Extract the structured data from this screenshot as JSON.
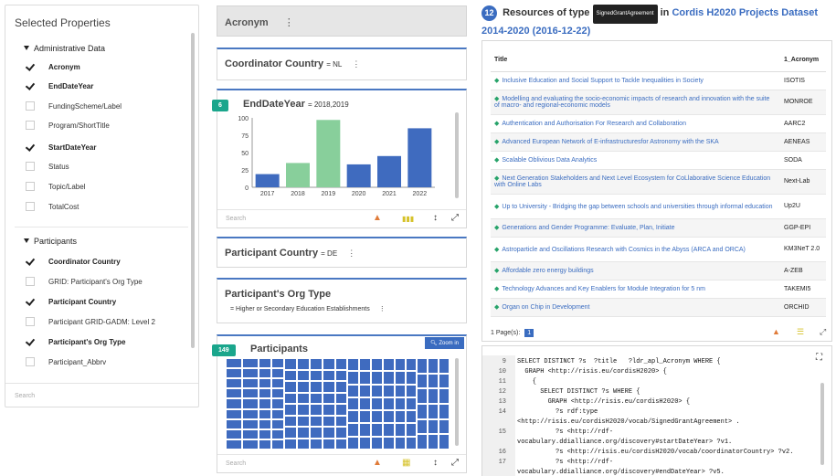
{
  "left_panel": {
    "title": "Selected Properties",
    "sections": [
      {
        "label": "Administrative Data",
        "items": [
          {
            "label": "Acronym",
            "checked": true
          },
          {
            "label": "EndDateYear",
            "checked": true
          },
          {
            "label": "FundingScheme/Label",
            "checked": false
          },
          {
            "label": "Program/ShortTitle",
            "checked": false
          },
          {
            "label": "StartDateYear",
            "checked": true
          },
          {
            "label": "Status",
            "checked": false
          },
          {
            "label": "Topic/Label",
            "checked": false
          },
          {
            "label": "TotalCost",
            "checked": false
          }
        ]
      },
      {
        "label": "Participants",
        "items": [
          {
            "label": "Coordinator Country",
            "checked": true
          },
          {
            "label": "GRID: Participant's Org Type",
            "checked": false
          },
          {
            "label": "Participant Country",
            "checked": true
          },
          {
            "label": "Participant GRID-GADM: Level 2",
            "checked": false
          },
          {
            "label": "Participant's Org Type",
            "checked": true
          },
          {
            "label": "Participant_Abbrv",
            "checked": false
          }
        ]
      }
    ],
    "search_placeholder": "Search"
  },
  "cards": {
    "acronym": {
      "title": "Acronym",
      "menu": "⋮"
    },
    "coordinator": {
      "title": "Coordinator Country",
      "filter": "= NL",
      "menu": "⋮"
    },
    "enddate": {
      "badge": "6",
      "title": "EndDateYear",
      "filter": "= 2018,2019",
      "search": "Search"
    },
    "participant_country": {
      "title": "Participant Country",
      "filter": "= DE",
      "menu": "⋮"
    },
    "org_type": {
      "title": "Participant's Org Type",
      "filter": "= Higher or Secondary Education Establishments",
      "menu": "⋮"
    },
    "participants": {
      "badge": "149",
      "title": "Participants",
      "zoom": "Zoom in",
      "search": "Search"
    }
  },
  "chart_data": {
    "type": "bar",
    "categories": [
      "2017",
      "2018",
      "2019",
      "2020",
      "2021",
      "2022"
    ],
    "values": [
      19,
      35,
      97,
      33,
      45,
      85
    ],
    "highlighted": [
      "2018",
      "2019"
    ],
    "ylim": [
      0,
      100
    ],
    "yticks": [
      "0",
      "25",
      "50",
      "75",
      "100"
    ],
    "colors": {
      "default": "#3f6bbf",
      "selected": "#88cf9b"
    }
  },
  "results": {
    "count": "12",
    "prefix": "Resources of type",
    "type_tag": "SignedGrantAgreement",
    "in_word": "in",
    "dataset": "Cordis H2020 Projects Dataset 2014-2020 (2016-12-22)",
    "columns": [
      "Title",
      "1_Acronym"
    ],
    "rows": [
      {
        "title": "Inclusive Education and Social Support to Tackle Inequalities in Society",
        "acronym": "ISOTIS"
      },
      {
        "title": "Modelling and evaluating the socio-economic impacts of research and innovation with the suite of macro- and regional-economic models",
        "acronym": "MONROE"
      },
      {
        "title": "Authentication and Authorisation For Research and Collaboration",
        "acronym": "AARC2"
      },
      {
        "title": "Advanced European Network of E-infrastructuresfor Astronomy with the SKA",
        "acronym": "AENEAS"
      },
      {
        "title": "Scalable Oblivious Data Analytics",
        "acronym": "SODA"
      },
      {
        "title": "Next Generation Stakeholders and Next Level Ecosystem for CoLlaborative Science Education with Online Labs",
        "acronym": "Next-Lab"
      },
      {
        "title": "Up to University - Bridging the gap between schools and universities through informal education",
        "acronym": "Up2U"
      },
      {
        "title": "Generations and Gender Programme: Evaluate, Plan, Initiate",
        "acronym": "GGP-EPI"
      },
      {
        "title": "Astroparticle and Oscillations Research with Cosmics in the Abyss (ARCA and ORCA)",
        "acronym": "KM3NeT 2.0"
      },
      {
        "title": "Affordable zero energy buildings",
        "acronym": "A-ZEB"
      },
      {
        "title": "Technology Advances and Key Enablers for Module Integration for 5 nm",
        "acronym": "TAKEMI5"
      },
      {
        "title": "Organ on Chip in Development",
        "acronym": "ORCHID"
      }
    ],
    "pages_label": "1 Page(s):",
    "page": "1"
  },
  "sparql": [
    {
      "n": "9",
      "t": "SELECT DISTINCT ?s  ?title   ?ldr_apl_Acronym WHERE {"
    },
    {
      "n": "10",
      "t": "  GRAPH <http://risis.eu/cordisH2020> {"
    },
    {
      "n": "11",
      "t": "    {"
    },
    {
      "n": "12",
      "t": "      SELECT DISTINCT ?s WHERE {"
    },
    {
      "n": "13",
      "t": "        GRAPH <http://risis.eu/cordisH2020> {"
    },
    {
      "n": "14",
      "t": "          ?s rdf:type"
    },
    {
      "n": "",
      "t": "<http://risis.eu/cordisH2020/vocab/SignedGrantAgreement> ."
    },
    {
      "n": "15",
      "t": "          ?s <http://rdf-"
    },
    {
      "n": "",
      "t": "vocabulary.ddialliance.org/discovery#startDateYear> ?v1."
    },
    {
      "n": "16",
      "t": "          ?s <http://risis.eu/cordisH2020/vocab/coordinatorCountry> ?v2."
    },
    {
      "n": "17",
      "t": "          ?s <http://rdf-"
    },
    {
      "n": "",
      "t": "vocabulary.ddialliance.org/discovery#endDateYear> ?v5."
    }
  ]
}
